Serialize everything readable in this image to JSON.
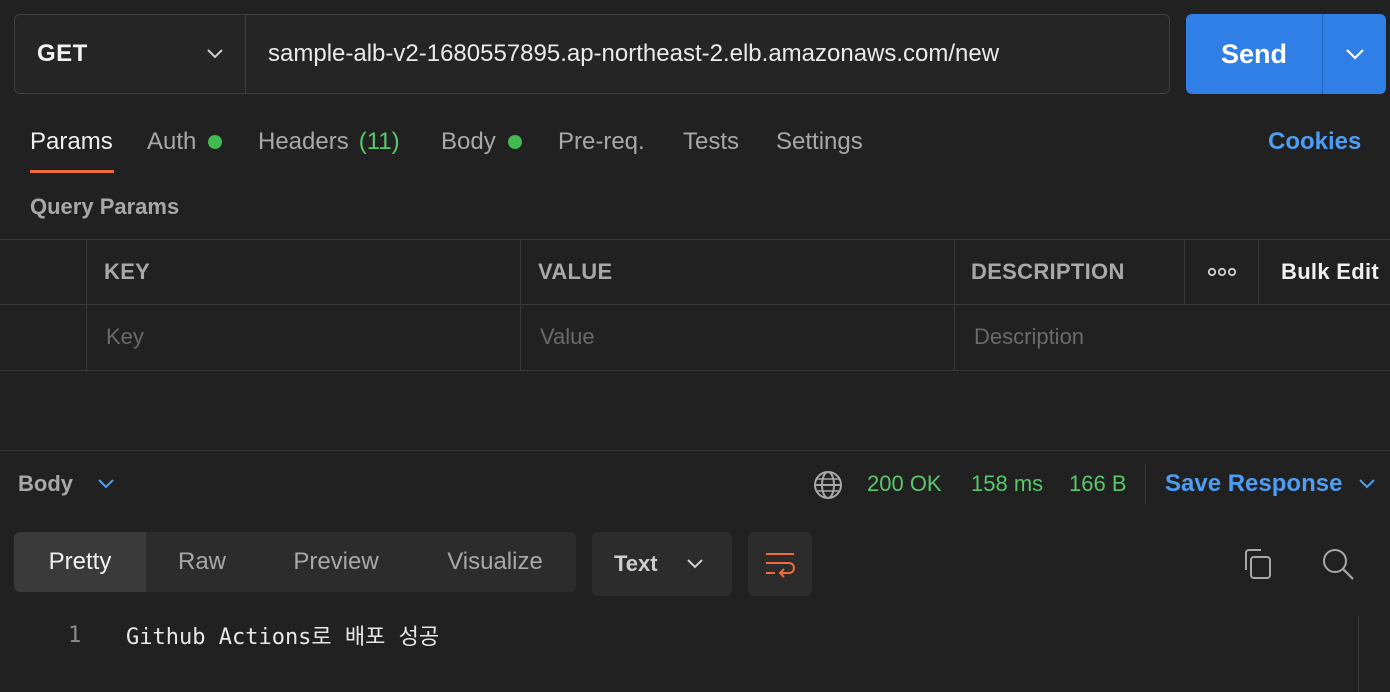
{
  "request": {
    "method": "GET",
    "url": "sample-alb-v2-1680557895.ap-northeast-2.elb.amazonaws.com/new",
    "send_label": "Send"
  },
  "tabs": [
    {
      "label": "Params",
      "active": true
    },
    {
      "label": "Auth",
      "indicator": true
    },
    {
      "label": "Headers",
      "count": "(11)"
    },
    {
      "label": "Body",
      "indicator": true
    },
    {
      "label": "Pre-req."
    },
    {
      "label": "Tests"
    },
    {
      "label": "Settings"
    }
  ],
  "cookies_label": "Cookies",
  "params": {
    "section_title": "Query Params",
    "columns": [
      "KEY",
      "VALUE",
      "DESCRIPTION"
    ],
    "more_label": "ooo",
    "bulk_edit_label": "Bulk Edit",
    "placeholders": [
      "Key",
      "Value",
      "Description"
    ]
  },
  "response": {
    "body_label": "Body",
    "status": "200 OK",
    "time": "158 ms",
    "size": "166 B",
    "save_label": "Save Response",
    "views": [
      "Pretty",
      "Raw",
      "Preview",
      "Visualize"
    ],
    "format": "Text",
    "lines": [
      {
        "no": "1",
        "text": "Github Actions로 배포 성공"
      }
    ]
  },
  "colors": {
    "accent_blue": "#2f7fe6",
    "link_blue": "#4e9df5",
    "success_green": "#58c86c",
    "active_tab_orange": "#f26b3a"
  }
}
